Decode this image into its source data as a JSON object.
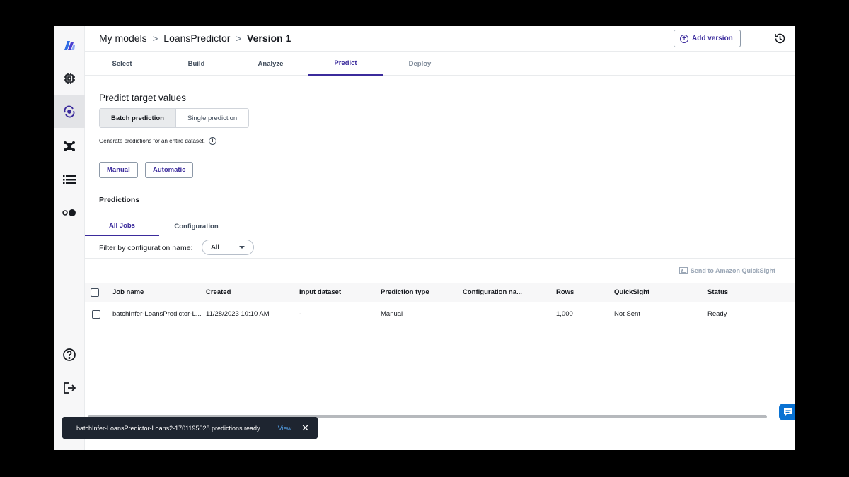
{
  "breadcrumb": {
    "items": [
      "My models",
      "LoansPredictor"
    ],
    "current": "Version 1",
    "separator": ">"
  },
  "header": {
    "add_version_label": "Add version"
  },
  "main_tabs": [
    {
      "label": "Select",
      "state": "normal"
    },
    {
      "label": "Build",
      "state": "normal"
    },
    {
      "label": "Analyze",
      "state": "normal"
    },
    {
      "label": "Predict",
      "state": "active"
    },
    {
      "label": "Deploy",
      "state": "muted"
    }
  ],
  "predict": {
    "title": "Predict target values",
    "segments": [
      "Batch prediction",
      "Single prediction"
    ],
    "hint": "Generate predictions for an entire dataset.",
    "info_icon": "i",
    "modes": [
      "Manual",
      "Automatic"
    ]
  },
  "predictions": {
    "title": "Predictions",
    "tabs": [
      "All Jobs",
      "Configuration"
    ],
    "filter_label": "Filter by configuration name:",
    "filter_value": "All",
    "quicksight_label": "Send to Amazon QuickSight",
    "columns": [
      "Job name",
      "Created",
      "Input dataset",
      "Prediction type",
      "Configuration na...",
      "Rows",
      "QuickSight",
      "Status"
    ],
    "rows": [
      [
        "batchInfer-LoansPredictor-L...",
        "11/28/2023 10:10 AM",
        "-",
        "Manual",
        "",
        "1,000",
        "Not Sent",
        "Ready"
      ]
    ]
  },
  "toast": {
    "message": "batchInfer-LoansPredictor-Loans2-1701195028 predictions ready",
    "action": "View",
    "close": "✕"
  },
  "colors": {
    "accent": "#3b2b9c",
    "link": "#539fe5",
    "toast_bg": "#1e2530",
    "chat": "#0972d3"
  }
}
